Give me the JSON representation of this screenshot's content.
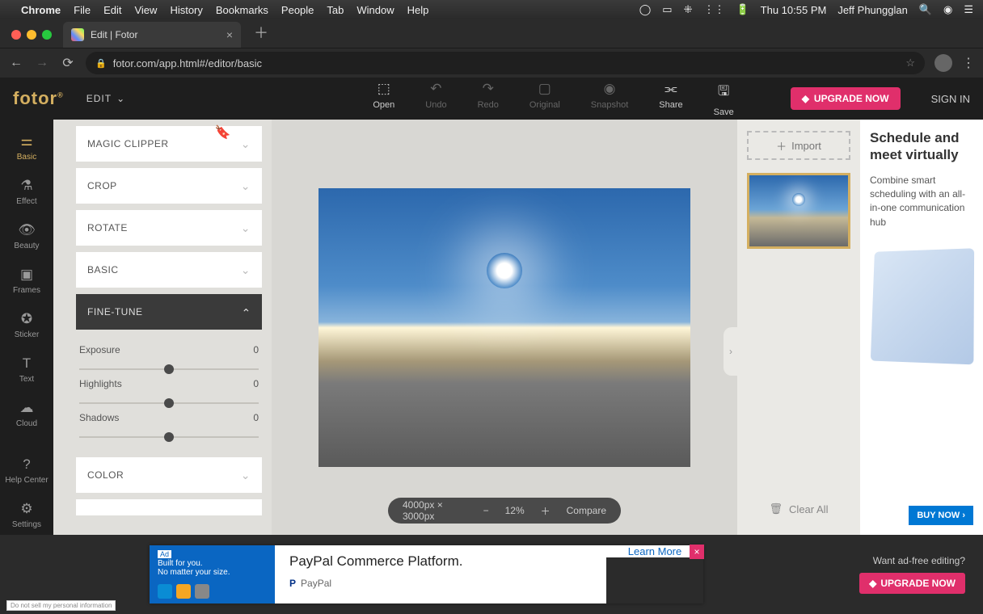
{
  "menubar": {
    "app": "Chrome",
    "items": [
      "File",
      "Edit",
      "View",
      "History",
      "Bookmarks",
      "People",
      "Tab",
      "Window",
      "Help"
    ],
    "clock": "Thu 10:55 PM",
    "user": "Jeff Phungglan"
  },
  "browser": {
    "tab_title": "Edit | Fotor",
    "url": "fotor.com/app.html#/editor/basic"
  },
  "header": {
    "logo": "fotor",
    "edit_menu": "EDIT",
    "tools": {
      "open": "Open",
      "undo": "Undo",
      "redo": "Redo",
      "original": "Original",
      "snapshot": "Snapshot",
      "share": "Share",
      "save": "Save"
    },
    "upgrade": "UPGRADE NOW",
    "signin": "SIGN IN"
  },
  "rail": {
    "basic": "Basic",
    "effect": "Effect",
    "beauty": "Beauty",
    "frames": "Frames",
    "sticker": "Sticker",
    "text": "Text",
    "cloud": "Cloud",
    "help": "Help Center",
    "settings": "Settings"
  },
  "panel": {
    "magic_clipper": "MAGIC CLIPPER",
    "crop": "CROP",
    "rotate": "ROTATE",
    "basic": "BASIC",
    "fine_tune": "FINE-TUNE",
    "color": "COLOR",
    "sliders": {
      "exposure": {
        "label": "Exposure",
        "value": "0"
      },
      "highlights": {
        "label": "Highlights",
        "value": "0"
      },
      "shadows": {
        "label": "Shadows",
        "value": "0"
      }
    }
  },
  "canvas": {
    "dimensions": "4000px × 3000px",
    "zoom": "12%",
    "compare": "Compare"
  },
  "rside": {
    "import": "Import",
    "clear": "Clear All"
  },
  "adcol": {
    "headline": "Schedule and meet virtually",
    "body": "Combine smart scheduling with an all-in-one communication hub",
    "cta": "BUY NOW ›"
  },
  "footer": {
    "ad_badge": "Ad",
    "ad_line1": "Built for you.",
    "ad_line2": "No matter your size.",
    "ad_headline": "PayPal Commerce Platform.",
    "ad_brand": "PayPal",
    "ad_learn": "Learn More",
    "adfree_q": "Want ad-free editing?",
    "upgrade": "UPGRADE NOW",
    "dnsell": "Do not sell my personal information"
  }
}
